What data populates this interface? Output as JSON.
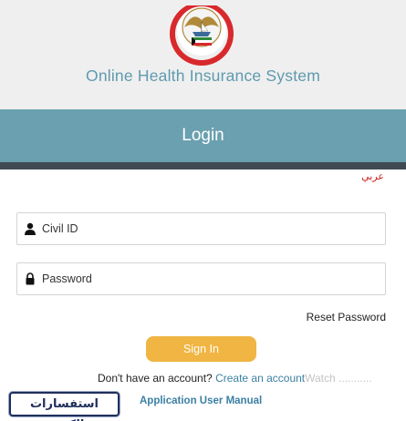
{
  "header": {
    "system_title": "Online Health Insurance System",
    "logo": "kuwait-ministry-emblem"
  },
  "login_bar": {
    "title": "Login"
  },
  "language_link": {
    "label": "عربي"
  },
  "form": {
    "civil_id": {
      "placeholder": "Civil ID",
      "icon": "user-icon"
    },
    "password": {
      "placeholder": "Password",
      "icon": "lock-icon"
    },
    "reset_label": "Reset Password",
    "signin_label": "Sign In"
  },
  "footer": {
    "no_account_text": "Don't have an account?",
    "create_account_label": "Create an account",
    "overlapped_text": "Watch ...........",
    "manual_label": "Application User Manual",
    "kuwait_inquiries_label": "استفسارات الكويت"
  },
  "colors": {
    "header_bg": "#efefef",
    "title_color": "#5e9aae",
    "login_bar": "#6aa0af",
    "dark_strip": "#3f4a52",
    "signin_button": "#f0b542",
    "link_blue": "#3b7fa3",
    "arabic_link": "#cc2020"
  }
}
